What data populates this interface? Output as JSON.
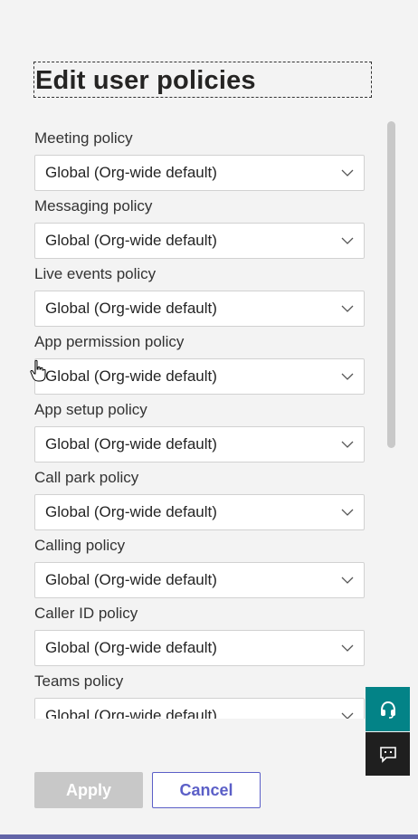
{
  "panel": {
    "title": "Edit user policies"
  },
  "policies": [
    {
      "label": "Meeting policy",
      "value": "Global (Org-wide default)"
    },
    {
      "label": "Messaging policy",
      "value": "Global (Org-wide default)"
    },
    {
      "label": "Live events policy",
      "value": "Global (Org-wide default)"
    },
    {
      "label": "App permission policy",
      "value": "Global (Org-wide default)"
    },
    {
      "label": "App setup policy",
      "value": "Global (Org-wide default)"
    },
    {
      "label": "Call park policy",
      "value": "Global (Org-wide default)"
    },
    {
      "label": "Calling policy",
      "value": "Global (Org-wide default)"
    },
    {
      "label": "Caller ID policy",
      "value": "Global (Org-wide default)"
    },
    {
      "label": "Teams policy",
      "value": "Global (Org-wide default)"
    }
  ],
  "footer": {
    "apply_label": "Apply",
    "cancel_label": "Cancel"
  },
  "side_buttons": {
    "help_icon": "headset-icon",
    "feedback_icon": "feedback-icon"
  },
  "colors": {
    "accent": "#5b5fc7",
    "help_teal": "#038387",
    "feedback_dark": "#1f1f1f",
    "brand_bar": "#6264a7",
    "disabled_button": "#c8c8c8"
  }
}
